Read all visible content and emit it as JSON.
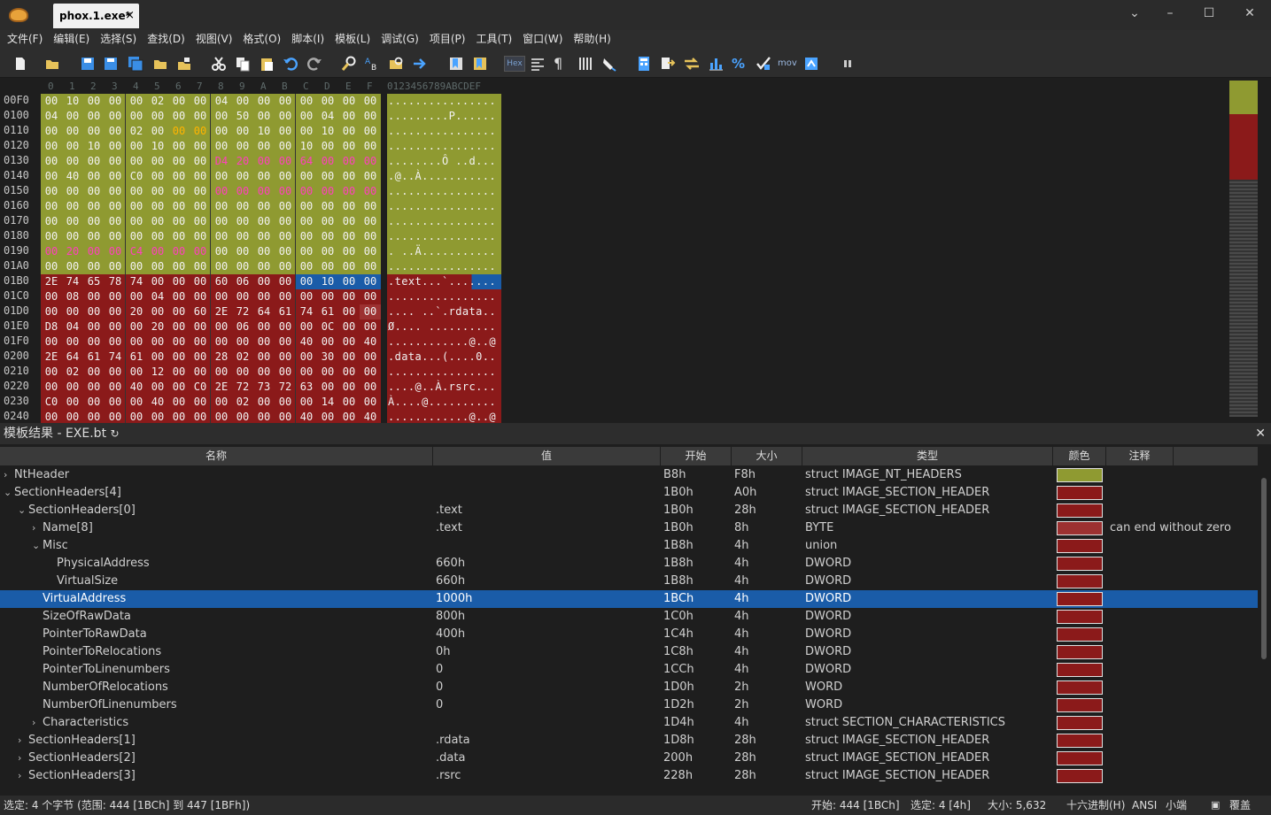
{
  "title": {
    "tab": "phox.1.exe*",
    "close": "×",
    "win_min": "–",
    "win_max": "☐",
    "win_close": "✕",
    "dropdown": "⌄"
  },
  "menu": [
    "文件(F)",
    "编辑(E)",
    "选择(S)",
    "查找(D)",
    "视图(V)",
    "格式(O)",
    "脚本(I)",
    "模板(L)",
    "调试(G)",
    "项目(P)",
    "工具(T)",
    "窗口(W)",
    "帮助(H)"
  ],
  "toolbar": {
    "hex_label": "Hex",
    "para": "¶",
    "mov_label": "mov",
    "percent": "%"
  },
  "hex": {
    "col_headers": [
      "0",
      "1",
      "2",
      "3",
      "4",
      "5",
      "6",
      "7",
      "8",
      "9",
      "A",
      "B",
      "C",
      "D",
      "E",
      "F"
    ],
    "ascii_header": "0123456789ABCDEF",
    "colors": {
      "nt": "#8f9a31",
      "sect": "#8b1a1a",
      "sect_light": "#9c3131",
      "sel": "#1a5ca8",
      "pink": "#ff3fbf",
      "orange": "#ffb400"
    },
    "rows": [
      {
        "addr": "00F0",
        "bytes": "00 10 00 00 00 02 00 00 04 00 00 00 00 00 00 00",
        "ascii": "................",
        "reg": "nnnnnnnnnnnnnnnn",
        "fc": "wwwwwwwwwwwwwwww"
      },
      {
        "addr": "0100",
        "bytes": "04 00 00 00 00 00 00 00 00 50 00 00 00 04 00 00",
        "ascii": ".........P......",
        "reg": "nnnnnnnnnnnnnnnn",
        "fc": "wwwwwwwwwwwwwwww"
      },
      {
        "addr": "0110",
        "bytes": "00 00 00 00 02 00 00 00 00 00 10 00 00 10 00 00",
        "ascii": "................",
        "reg": "nnnnnnnnnnnnnnnn",
        "fc": "wwwwwwoowwwwwwww"
      },
      {
        "addr": "0120",
        "bytes": "00 00 10 00 00 10 00 00 00 00 00 00 10 00 00 00",
        "ascii": "................",
        "reg": "nnnnnnnnnnnnnnnn",
        "fc": "wwwwwwwwwwwwwwww"
      },
      {
        "addr": "0130",
        "bytes": "00 00 00 00 00 00 00 00 D4 20 00 00 64 00 00 00",
        "ascii": "........Ô ..d...",
        "reg": "nnnnnnnnnnnnnnnn",
        "fc": "wwwwwwwwppppppppp"
      },
      {
        "addr": "0140",
        "bytes": "00 40 00 00 C0 00 00 00 00 00 00 00 00 00 00 00",
        "ascii": ".@..À...........",
        "reg": "nnnnnnnnnnnnnnnn",
        "fc": "wwwwwwwwwwwwwwww"
      },
      {
        "addr": "0150",
        "bytes": "00 00 00 00 00 00 00 00 00 00 00 00 00 00 00 00",
        "ascii": "................",
        "reg": "nnnnnnnnnnnnnnnn",
        "fc": "wwwwwwwwpppppppp"
      },
      {
        "addr": "0160",
        "bytes": "00 00 00 00 00 00 00 00 00 00 00 00 00 00 00 00",
        "ascii": "................",
        "reg": "nnnnnnnnnnnnnnnn",
        "fc": "wwwwwwwwwwwwwwww"
      },
      {
        "addr": "0170",
        "bytes": "00 00 00 00 00 00 00 00 00 00 00 00 00 00 00 00",
        "ascii": "................",
        "reg": "nnnnnnnnnnnnnnnn",
        "fc": "wwwwwwwwwwwwwwww"
      },
      {
        "addr": "0180",
        "bytes": "00 00 00 00 00 00 00 00 00 00 00 00 00 00 00 00",
        "ascii": "................",
        "reg": "nnnnnnnnnnnnnnnn",
        "fc": "wwwwwwwwwwwwwwww"
      },
      {
        "addr": "0190",
        "bytes": "00 20 00 00 C4 00 00 00 00 00 00 00 00 00 00 00",
        "ascii": ". ..Ä...........",
        "reg": "nnnnnnnnnnnnnnnn",
        "fc": "ppppppppwwwwwwww"
      },
      {
        "addr": "01A0",
        "bytes": "00 00 00 00 00 00 00 00 00 00 00 00 00 00 00 00",
        "ascii": "................",
        "reg": "nnnnnnnnnnnnnnnn",
        "fc": "wwwwwwwwwwwwwwww"
      },
      {
        "addr": "01B0",
        "bytes": "2E 74 65 78 74 00 00 00 60 06 00 00 00 10 00 00",
        "ascii": ".text...`.......",
        "reg": "rrrrrrrrrrrrssss",
        "fc": "wwwwwwwwwwwwwwww"
      },
      {
        "addr": "01C0",
        "bytes": "00 08 00 00 00 04 00 00 00 00 00 00 00 00 00 00",
        "ascii": "................",
        "reg": "rrrrrrrrrrrrrrrr",
        "fc": "wwwwwwwwwwwwwwww"
      },
      {
        "addr": "01D0",
        "bytes": "00 00 00 00 20 00 00 60 2E 72 64 61 74 61 00 00",
        "ascii": ".... ..`.rdata..",
        "reg": "rrrrrrrrrrrrrrrl",
        "fc": "wwwwwwwwwwwwwwww"
      },
      {
        "addr": "01E0",
        "bytes": "D8 04 00 00 00 20 00 00 00 06 00 00 00 0C 00 00",
        "ascii": "Ø.... ..........",
        "reg": "rrrrrrrrrrrrrrrr",
        "fc": "wwwwwwwwwwwwwwww"
      },
      {
        "addr": "01F0",
        "bytes": "00 00 00 00 00 00 00 00 00 00 00 00 40 00 00 40",
        "ascii": "............@..@",
        "reg": "rrrrrrrrrrrrrrrr",
        "fc": "wwwwwwwwwwwwwwww"
      },
      {
        "addr": "0200",
        "bytes": "2E 64 61 74 61 00 00 00 28 02 00 00 00 30 00 00",
        "ascii": ".data...(....0..",
        "reg": "rrrrrrrrrrrrrrrr",
        "fc": "wwwwwwwwwwwwwwww"
      },
      {
        "addr": "0210",
        "bytes": "00 02 00 00 00 12 00 00 00 00 00 00 00 00 00 00",
        "ascii": "................",
        "reg": "rrrrrrrrrrrrrrrr",
        "fc": "wwwwwwwwwwwwwwww"
      },
      {
        "addr": "0220",
        "bytes": "00 00 00 00 40 00 00 C0 2E 72 73 72 63 00 00 00",
        "ascii": "....@..À.rsrc...",
        "reg": "rrrrrrrrrrrrrrrr",
        "fc": "wwwwwwwwwwwwwwww"
      },
      {
        "addr": "0230",
        "bytes": "C0 00 00 00 00 40 00 00 00 02 00 00 00 14 00 00",
        "ascii": "À....@..........",
        "reg": "rrrrrrrrrrrrrrrr",
        "fc": "wwwwwwwwwwwwwwww"
      },
      {
        "addr": "0240",
        "bytes": "00 00 00 00 00 00 00 00 00 00 00 00 40 00 00 40",
        "ascii": "............@..@",
        "reg": "rrrrrrrrrrrrrrrr",
        "fc": "wwwwwwwwwwwwwwww"
      }
    ]
  },
  "template": {
    "header": "模板结果 - EXE.bt",
    "refresh": "↻",
    "close": "✕",
    "columns": [
      "名称",
      "值",
      "开始",
      "大小",
      "类型",
      "颜色",
      "注释"
    ],
    "rows": [
      {
        "indent": 0,
        "chev": "›",
        "name": "NtHeader",
        "value": "",
        "start": "B8h",
        "size": "F8h",
        "type": "struct IMAGE_NT_HEADERS",
        "color": "#8f9a31",
        "comment": ""
      },
      {
        "indent": 0,
        "chev": "⌄",
        "name": "SectionHeaders[4]",
        "value": "",
        "start": "1B0h",
        "size": "A0h",
        "type": "struct IMAGE_SECTION_HEADER",
        "color": "#8b1a1a",
        "comment": ""
      },
      {
        "indent": 1,
        "chev": "⌄",
        "name": "SectionHeaders[0]",
        "value": ".text",
        "start": "1B0h",
        "size": "28h",
        "type": "struct IMAGE_SECTION_HEADER",
        "color": "#8b1a1a",
        "comment": ""
      },
      {
        "indent": 2,
        "chev": "›",
        "name": "Name[8]",
        "value": ".text",
        "start": "1B0h",
        "size": "8h",
        "type": "BYTE",
        "color": "#9c3131",
        "comment": "can end without zero"
      },
      {
        "indent": 2,
        "chev": "⌄",
        "name": "Misc",
        "value": "",
        "start": "1B8h",
        "size": "4h",
        "type": "union",
        "color": "#8b1a1a",
        "comment": ""
      },
      {
        "indent": 3,
        "chev": "",
        "name": "PhysicalAddress",
        "value": "660h",
        "start": "1B8h",
        "size": "4h",
        "type": "DWORD",
        "color": "#8b1a1a",
        "comment": ""
      },
      {
        "indent": 3,
        "chev": "",
        "name": "VirtualSize",
        "value": "660h",
        "start": "1B8h",
        "size": "4h",
        "type": "DWORD",
        "color": "#8b1a1a",
        "comment": ""
      },
      {
        "indent": 2,
        "chev": "",
        "name": "VirtualAddress",
        "value": "1000h",
        "start": "1BCh",
        "size": "4h",
        "type": "DWORD",
        "color": "#8b1a1a",
        "comment": "",
        "selected": true
      },
      {
        "indent": 2,
        "chev": "",
        "name": "SizeOfRawData",
        "value": "800h",
        "start": "1C0h",
        "size": "4h",
        "type": "DWORD",
        "color": "#8b1a1a",
        "comment": ""
      },
      {
        "indent": 2,
        "chev": "",
        "name": "PointerToRawData",
        "value": "400h",
        "start": "1C4h",
        "size": "4h",
        "type": "DWORD",
        "color": "#8b1a1a",
        "comment": ""
      },
      {
        "indent": 2,
        "chev": "",
        "name": "PointerToRelocations",
        "value": "0h",
        "start": "1C8h",
        "size": "4h",
        "type": "DWORD",
        "color": "#8b1a1a",
        "comment": ""
      },
      {
        "indent": 2,
        "chev": "",
        "name": "PointerToLinenumbers",
        "value": "0",
        "start": "1CCh",
        "size": "4h",
        "type": "DWORD",
        "color": "#8b1a1a",
        "comment": ""
      },
      {
        "indent": 2,
        "chev": "",
        "name": "NumberOfRelocations",
        "value": "0",
        "start": "1D0h",
        "size": "2h",
        "type": "WORD",
        "color": "#8b1a1a",
        "comment": ""
      },
      {
        "indent": 2,
        "chev": "",
        "name": "NumberOfLinenumbers",
        "value": "0",
        "start": "1D2h",
        "size": "2h",
        "type": "WORD",
        "color": "#8b1a1a",
        "comment": ""
      },
      {
        "indent": 2,
        "chev": "›",
        "name": "Characteristics",
        "value": "",
        "start": "1D4h",
        "size": "4h",
        "type": "struct SECTION_CHARACTERISTICS",
        "color": "#8b1a1a",
        "comment": ""
      },
      {
        "indent": 1,
        "chev": "›",
        "name": "SectionHeaders[1]",
        "value": ".rdata",
        "start": "1D8h",
        "size": "28h",
        "type": "struct IMAGE_SECTION_HEADER",
        "color": "#8b1a1a",
        "comment": ""
      },
      {
        "indent": 1,
        "chev": "›",
        "name": "SectionHeaders[2]",
        "value": ".data",
        "start": "200h",
        "size": "28h",
        "type": "struct IMAGE_SECTION_HEADER",
        "color": "#8b1a1a",
        "comment": ""
      },
      {
        "indent": 1,
        "chev": "›",
        "name": "SectionHeaders[3]",
        "value": ".rsrc",
        "start": "228h",
        "size": "28h",
        "type": "struct IMAGE_SECTION_HEADER",
        "color": "#8b1a1a",
        "comment": ""
      }
    ]
  },
  "status": {
    "selection": "选定: 4 个字节 (范围: 444 [1BCh] 到 447 [1BFh])",
    "start": "开始: 444 [1BCh]",
    "selected": "选定: 4 [4h]",
    "size": "大小: 5,632",
    "mode": "十六进制(H)",
    "encoding": "ANSI",
    "endian": "小端",
    "overwrite": "覆盖"
  }
}
